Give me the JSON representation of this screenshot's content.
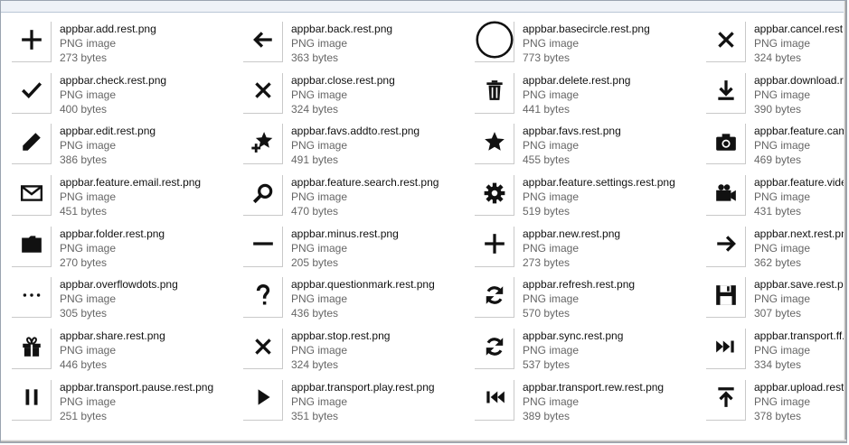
{
  "files": [
    {
      "name": "appbar.add.rest.png",
      "type": "PNG image",
      "size": "273 bytes",
      "icon": "plus-icon"
    },
    {
      "name": "appbar.back.rest.png",
      "type": "PNG image",
      "size": "363 bytes",
      "icon": "arrow-left-icon"
    },
    {
      "name": "appbar.basecircle.rest.png",
      "type": "PNG image",
      "size": "773 bytes",
      "icon": "circle-icon"
    },
    {
      "name": "appbar.cancel.rest.png",
      "type": "PNG image",
      "size": "324 bytes",
      "icon": "x-icon"
    },
    {
      "name": "appbar.check.rest.png",
      "type": "PNG image",
      "size": "400 bytes",
      "icon": "check-icon"
    },
    {
      "name": "appbar.close.rest.png",
      "type": "PNG image",
      "size": "324 bytes",
      "icon": "x-icon"
    },
    {
      "name": "appbar.delete.rest.png",
      "type": "PNG image",
      "size": "441 bytes",
      "icon": "trash-icon"
    },
    {
      "name": "appbar.download.rest.png",
      "type": "PNG image",
      "size": "390 bytes",
      "icon": "download-icon"
    },
    {
      "name": "appbar.edit.rest.png",
      "type": "PNG image",
      "size": "386 bytes",
      "icon": "pencil-icon"
    },
    {
      "name": "appbar.favs.addto.rest.png",
      "type": "PNG image",
      "size": "491 bytes",
      "icon": "star-plus-icon"
    },
    {
      "name": "appbar.favs.rest.png",
      "type": "PNG image",
      "size": "455 bytes",
      "icon": "star-icon"
    },
    {
      "name": "appbar.feature.camera.rest.png",
      "type": "PNG image",
      "size": "469 bytes",
      "icon": "camera-icon"
    },
    {
      "name": "appbar.feature.email.rest.png",
      "type": "PNG image",
      "size": "451 bytes",
      "icon": "mail-icon"
    },
    {
      "name": "appbar.feature.search.rest.png",
      "type": "PNG image",
      "size": "470 bytes",
      "icon": "search-icon"
    },
    {
      "name": "appbar.feature.settings.rest.png",
      "type": "PNG image",
      "size": "519 bytes",
      "icon": "gear-icon"
    },
    {
      "name": "appbar.feature.video.rest.png",
      "type": "PNG image",
      "size": "431 bytes",
      "icon": "video-icon"
    },
    {
      "name": "appbar.folder.rest.png",
      "type": "PNG image",
      "size": "270 bytes",
      "icon": "folder-icon"
    },
    {
      "name": "appbar.minus.rest.png",
      "type": "PNG image",
      "size": "205 bytes",
      "icon": "minus-icon"
    },
    {
      "name": "appbar.new.rest.png",
      "type": "PNG image",
      "size": "273 bytes",
      "icon": "plus-icon"
    },
    {
      "name": "appbar.next.rest.png",
      "type": "PNG image",
      "size": "362 bytes",
      "icon": "arrow-right-icon"
    },
    {
      "name": "appbar.overflowdots.png",
      "type": "PNG image",
      "size": "305 bytes",
      "icon": "dots-icon"
    },
    {
      "name": "appbar.questionmark.rest.png",
      "type": "PNG image",
      "size": "436 bytes",
      "icon": "question-icon"
    },
    {
      "name": "appbar.refresh.rest.png",
      "type": "PNG image",
      "size": "570 bytes",
      "icon": "refresh-icon"
    },
    {
      "name": "appbar.save.rest.png",
      "type": "PNG image",
      "size": "307 bytes",
      "icon": "save-icon"
    },
    {
      "name": "appbar.share.rest.png",
      "type": "PNG image",
      "size": "446 bytes",
      "icon": "gift-icon"
    },
    {
      "name": "appbar.stop.rest.png",
      "type": "PNG image",
      "size": "324 bytes",
      "icon": "x-icon"
    },
    {
      "name": "appbar.sync.rest.png",
      "type": "PNG image",
      "size": "537 bytes",
      "icon": "refresh-icon"
    },
    {
      "name": "appbar.transport.ff.rest.png",
      "type": "PNG image",
      "size": "334 bytes",
      "icon": "fast-forward-icon"
    },
    {
      "name": "appbar.transport.pause.rest.png",
      "type": "PNG image",
      "size": "251 bytes",
      "icon": "pause-icon"
    },
    {
      "name": "appbar.transport.play.rest.png",
      "type": "PNG image",
      "size": "351 bytes",
      "icon": "play-icon"
    },
    {
      "name": "appbar.transport.rew.rest.png",
      "type": "PNG image",
      "size": "389 bytes",
      "icon": "rewind-icon"
    },
    {
      "name": "appbar.upload.rest.png",
      "type": "PNG image",
      "size": "378 bytes",
      "icon": "upload-icon"
    }
  ]
}
